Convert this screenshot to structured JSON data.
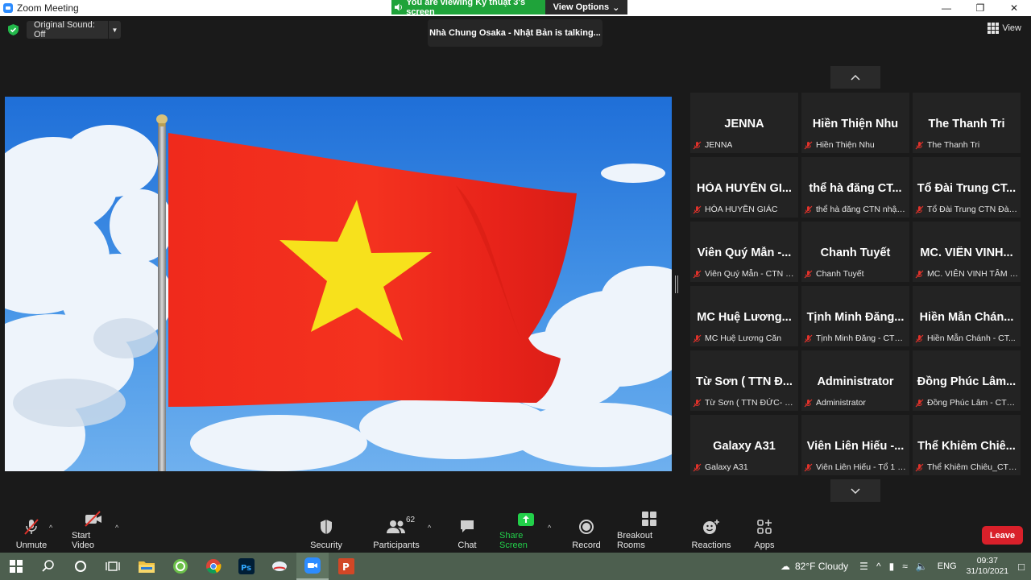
{
  "window": {
    "title": "Zoom Meeting"
  },
  "banner": {
    "viewing": "You are viewing Kỹ thuật 3's screen",
    "view_options": "View Options"
  },
  "header": {
    "original_sound": "Original Sound: Off",
    "talking": "Nhà Chung Osaka - Nhật Bản is talking...",
    "view": "View"
  },
  "participants": [
    {
      "display": "JENNA",
      "name": "JENNA"
    },
    {
      "display": "Hiền Thiện Nhu",
      "name": "Hiền Thiện Nhu"
    },
    {
      "display": "The Thanh Tri",
      "name": "The Thanh Tri"
    },
    {
      "display": "HÒA HUYỀN GI...",
      "name": "HÒA HUYỀN GIÁC"
    },
    {
      "display": "thể hà đăng CT...",
      "name": "thể hà đăng CTN nhật ..."
    },
    {
      "display": "Tổ Đài Trung CT...",
      "name": "Tổ Đài Trung CTN Đài ..."
    },
    {
      "display": "Viên Quý Mẫn -...",
      "name": "Viên Quý Mẫn - CTN N..."
    },
    {
      "display": "Chanh Tuyết",
      "name": "Chanh Tuyết"
    },
    {
      "display": "MC. VIÊN VINH...",
      "name": "MC. VIÊN VINH TÂM C..."
    },
    {
      "display": "MC Huệ Lương...",
      "name": "MC Huệ Lương Căn"
    },
    {
      "display": "Tịnh Minh Đăng...",
      "name": "Tịnh Minh Đăng - CTN ..."
    },
    {
      "display": "Hiền Mẫn Chán...",
      "name": "Hiền Mẫn Chánh - CT..."
    },
    {
      "display": "Từ Sơn ( TTN Đ...",
      "name": "Từ Sơn ( TTN ĐỨC- NG..."
    },
    {
      "display": "Administrator",
      "name": "Administrator"
    },
    {
      "display": "Đồng Phúc Lâm...",
      "name": "Đồng Phúc Lâm - CTN ..."
    },
    {
      "display": "Galaxy A31",
      "name": "Galaxy A31"
    },
    {
      "display": "Viên Liên Hiếu -...",
      "name": "Viên Liên Hiếu - Tổ 1 C..."
    },
    {
      "display": "Thể Khiêm Chiê...",
      "name": "Thể Khiêm Chiêu_CTN ..."
    }
  ],
  "toolbar": {
    "unmute": "Unmute",
    "start_video": "Start Video",
    "security": "Security",
    "participants": "Participants",
    "participants_count": "62",
    "chat": "Chat",
    "share_screen": "Share Screen",
    "record": "Record",
    "breakout_rooms": "Breakout Rooms",
    "reactions": "Reactions",
    "apps": "Apps",
    "leave": "Leave"
  },
  "taskbar": {
    "weather": "82°F  Cloudy",
    "language": "ENG",
    "time": "09:37",
    "date": "31/10/2021"
  },
  "colors": {
    "share_green": "#22d04a",
    "leave_red": "#d9202a",
    "flag_red": "#f2261c",
    "flag_star": "#f7e11c"
  }
}
